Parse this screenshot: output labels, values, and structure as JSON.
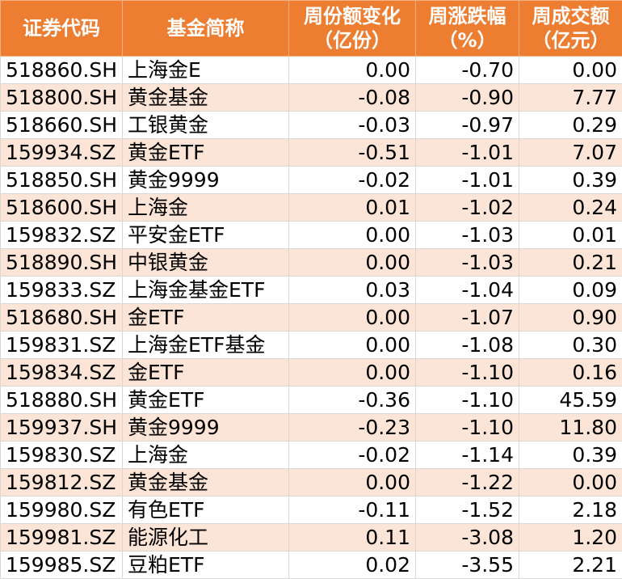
{
  "header": {
    "col1": "证券代码",
    "col2": "基金简称",
    "col3_line1": "周份额变化",
    "col3_line2": "（亿份）",
    "col4_line1": "周涨跌幅",
    "col4_line2": "（%）",
    "col5_line1": "周成交额",
    "col5_line2": "（亿元）"
  },
  "rows": [
    {
      "code": "518860.SH",
      "name": "上海金E",
      "share_change": "0.00",
      "weekly_return": "-0.70",
      "turnover": "0.00"
    },
    {
      "code": "518800.SH",
      "name": "黄金基金",
      "share_change": "-0.08",
      "weekly_return": "-0.90",
      "turnover": "7.77"
    },
    {
      "code": "518660.SH",
      "name": "工银黄金",
      "share_change": "-0.03",
      "weekly_return": "-0.97",
      "turnover": "0.29"
    },
    {
      "code": "159934.SZ",
      "name": "黄金ETF",
      "share_change": "-0.51",
      "weekly_return": "-1.01",
      "turnover": "7.07"
    },
    {
      "code": "518850.SH",
      "name": "黄金9999",
      "share_change": "-0.02",
      "weekly_return": "-1.01",
      "turnover": "0.39"
    },
    {
      "code": "518600.SH",
      "name": "上海金",
      "share_change": "0.01",
      "weekly_return": "-1.02",
      "turnover": "0.24"
    },
    {
      "code": "159832.SZ",
      "name": "平安金ETF",
      "share_change": "0.00",
      "weekly_return": "-1.03",
      "turnover": "0.01"
    },
    {
      "code": "518890.SH",
      "name": "中银黄金",
      "share_change": "0.00",
      "weekly_return": "-1.03",
      "turnover": "0.21"
    },
    {
      "code": "159833.SZ",
      "name": "上海金基金ETF",
      "share_change": "0.03",
      "weekly_return": "-1.04",
      "turnover": "0.09"
    },
    {
      "code": "518680.SH",
      "name": "金ETF",
      "share_change": "0.00",
      "weekly_return": "-1.07",
      "turnover": "0.90"
    },
    {
      "code": "159831.SZ",
      "name": "上海金ETF基金",
      "share_change": "0.00",
      "weekly_return": "-1.08",
      "turnover": "0.30"
    },
    {
      "code": "159834.SZ",
      "name": "金ETF",
      "share_change": "0.00",
      "weekly_return": "-1.10",
      "turnover": "0.16"
    },
    {
      "code": "518880.SH",
      "name": "黄金ETF",
      "share_change": "-0.36",
      "weekly_return": "-1.10",
      "turnover": "45.59"
    },
    {
      "code": "159937.SH",
      "name": "黄金9999",
      "share_change": "-0.23",
      "weekly_return": "-1.10",
      "turnover": "11.80"
    },
    {
      "code": "159830.SZ",
      "name": "上海金",
      "share_change": "-0.02",
      "weekly_return": "-1.14",
      "turnover": "0.39"
    },
    {
      "code": "159812.SZ",
      "name": "黄金基金",
      "share_change": "0.00",
      "weekly_return": "-1.22",
      "turnover": "0.00"
    },
    {
      "code": "159980.SZ",
      "name": "有色ETF",
      "share_change": "-0.11",
      "weekly_return": "-1.52",
      "turnover": "2.18"
    },
    {
      "code": "159981.SZ",
      "name": "能源化工",
      "share_change": "0.11",
      "weekly_return": "-3.08",
      "turnover": "1.20"
    },
    {
      "code": "159985.SZ",
      "name": "豆粕ETF",
      "share_change": "0.02",
      "weekly_return": "-3.55",
      "turnover": "2.21"
    }
  ],
  "colors": {
    "header_bg": "#ED7D31",
    "header_text": "#FFFFFF",
    "stripe_bg": "#FCE4D6"
  }
}
